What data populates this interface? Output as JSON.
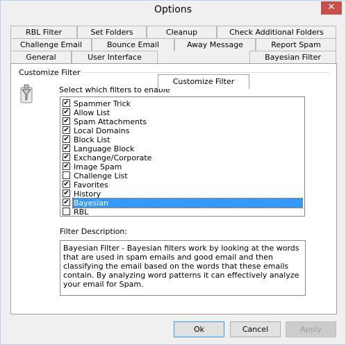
{
  "window": {
    "title": "Options",
    "close_glyph": "✕"
  },
  "tabs": {
    "row1": [
      "RBL Filter",
      "Set Folders",
      "Cleanup",
      "Check Additional Folders"
    ],
    "row2": [
      "Challenge Email",
      "Bounce Email",
      "Away Message",
      "Report Spam"
    ],
    "row3": [
      "General",
      "User Interface",
      "Customize Filter",
      "Bayesian Filter"
    ],
    "active": "Customize Filter"
  },
  "customize": {
    "group_title": "Customize Filter",
    "select_label": "Select which filters to enable",
    "filters": [
      {
        "label": "Spammer Trick",
        "checked": true
      },
      {
        "label": "Allow List",
        "checked": true
      },
      {
        "label": "Spam Attachments",
        "checked": true
      },
      {
        "label": "Local Domains",
        "checked": true
      },
      {
        "label": "Block List",
        "checked": true
      },
      {
        "label": "Language Block",
        "checked": true
      },
      {
        "label": "Exchange/Corporate",
        "checked": true
      },
      {
        "label": "Image Spam",
        "checked": true
      },
      {
        "label": "Challenge List",
        "checked": false
      },
      {
        "label": "Favorites",
        "checked": true
      },
      {
        "label": "History",
        "checked": true
      },
      {
        "label": "Bayesian",
        "checked": true,
        "selected": true
      },
      {
        "label": "RBL",
        "checked": false
      }
    ],
    "description_label": "Filter Description:",
    "description": "Bayesian Filter - Bayesian filters work by looking at the words that are used in spam emails and good email and then classifying the email based on the words that these emails contain. By analyzing word patterns it can effectively analyze your email for Spam."
  },
  "buttons": {
    "ok": "Ok",
    "cancel": "Cancel",
    "apply": "Apply"
  },
  "colors": {
    "selection": "#3399ff",
    "close": "#c7514a",
    "border": "#b9d1ea"
  },
  "icons": {
    "filter": "funnel-filter-icon",
    "close": "close-icon"
  }
}
